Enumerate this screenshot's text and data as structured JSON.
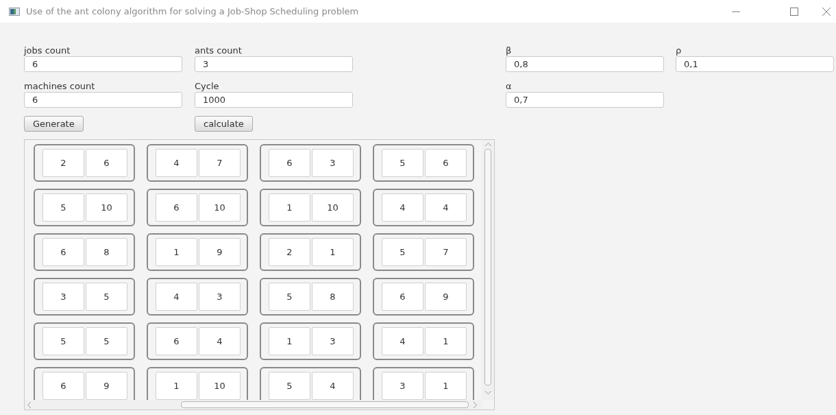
{
  "window": {
    "title": "Use of the ant colony algorithm for solving a Job-Shop Scheduling problem"
  },
  "fields": [
    {
      "label": "jobs count",
      "value": "6"
    },
    {
      "label": "ants count",
      "value": "3"
    },
    {
      "label": "β",
      "value": "0,8"
    },
    {
      "label": "ρ",
      "value": "0,1"
    },
    {
      "label": "machines count",
      "value": "6"
    },
    {
      "label": "Cycle",
      "value": "1000"
    },
    {
      "label": "α",
      "value": "0,7"
    }
  ],
  "buttons": [
    "Generate",
    "calculate"
  ],
  "grid": {
    "rows": [
      [
        [
          "2",
          "6"
        ],
        [
          "4",
          "7"
        ],
        [
          "6",
          "3"
        ],
        [
          "5",
          "6"
        ]
      ],
      [
        [
          "5",
          "10"
        ],
        [
          "6",
          "10"
        ],
        [
          "1",
          "10"
        ],
        [
          "4",
          "4"
        ]
      ],
      [
        [
          "6",
          "8"
        ],
        [
          "1",
          "9"
        ],
        [
          "2",
          "1"
        ],
        [
          "5",
          "7"
        ]
      ],
      [
        [
          "3",
          "5"
        ],
        [
          "4",
          "3"
        ],
        [
          "5",
          "8"
        ],
        [
          "6",
          "9"
        ]
      ],
      [
        [
          "5",
          "5"
        ],
        [
          "6",
          "4"
        ],
        [
          "1",
          "3"
        ],
        [
          "4",
          "1"
        ]
      ],
      [
        [
          "6",
          "9"
        ],
        [
          "1",
          "10"
        ],
        [
          "5",
          "4"
        ],
        [
          "3",
          "1"
        ]
      ]
    ]
  }
}
